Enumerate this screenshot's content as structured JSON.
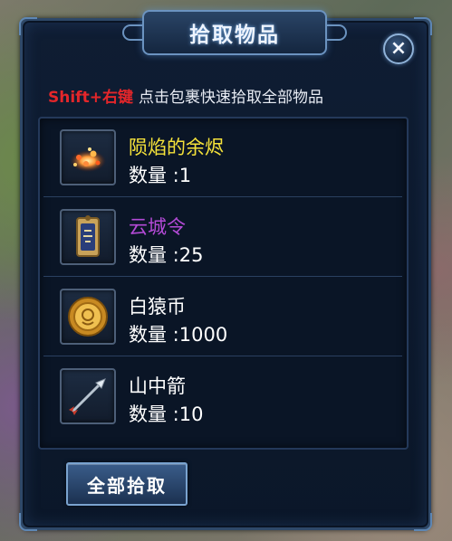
{
  "window": {
    "title": "拾取物品",
    "close_label": "×"
  },
  "hint": {
    "key": "Shift+右键",
    "text": "点击包裹快速拾取全部物品"
  },
  "items": [
    {
      "name": "陨焰的余烬",
      "count": "数量 :1",
      "name_color": "#f5e23a",
      "icon": "ember-icon"
    },
    {
      "name": "云城令",
      "count": "数量 :25",
      "name_color": "#b34ad6",
      "icon": "token-icon"
    },
    {
      "name": "白猿币",
      "count": "数量 :1000",
      "name_color": "#ffffff",
      "icon": "coin-icon"
    },
    {
      "name": "山中箭",
      "count": "数量 :10",
      "name_color": "#ffffff",
      "icon": "arrow-icon"
    }
  ],
  "actions": {
    "take_all_label": "全部拾取"
  },
  "colors": {
    "accent": "#6b93c0",
    "hint_key": "#e3262a",
    "panel_bg": "#0f1d33"
  }
}
